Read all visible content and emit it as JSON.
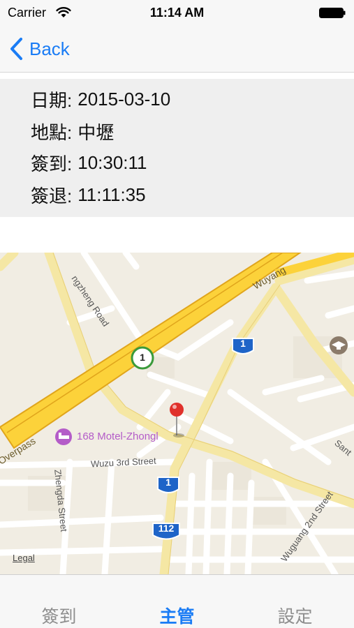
{
  "status_bar": {
    "carrier": "Carrier",
    "time": "11:14 AM",
    "wifi_icon": "wifi-icon",
    "battery_icon": "battery-icon"
  },
  "nav": {
    "back_label": "Back",
    "back_icon": "chevron-left-icon",
    "accent_color": "#1a7cf5"
  },
  "info": {
    "date_label": "日期:",
    "date_value": "2015-03-10",
    "location_label": "地點:",
    "location_value": "中壢",
    "checkin_label": "簽到:",
    "checkin_value": "10:30:11",
    "checkout_label": "簽退:",
    "checkout_value": "11:11:35"
  },
  "map": {
    "labels": {
      "road_zhongzheng": "ngzheng Road",
      "road_wuyang": "Wuyang",
      "road_overpass": "Overpass",
      "motel": "168 Motel-Zhongl",
      "street_wuzu3": "Wuzu 3rd Street",
      "street_zhengda": "Zhengda Street",
      "street_wuguang2": "Wuguang 2nd Street",
      "road_right_edge": "Sant",
      "shield_1": "1",
      "shield_112": "112",
      "poi_badge": "1",
      "legal": "Legal"
    },
    "pin_icon": "map-pin-icon",
    "school_icon": "school-icon",
    "bed_icon": "bed-icon",
    "pin_color": "#e0312b"
  },
  "tabs": [
    {
      "label": "簽到",
      "active": false
    },
    {
      "label": "主管",
      "active": true
    },
    {
      "label": "設定",
      "active": false
    }
  ]
}
